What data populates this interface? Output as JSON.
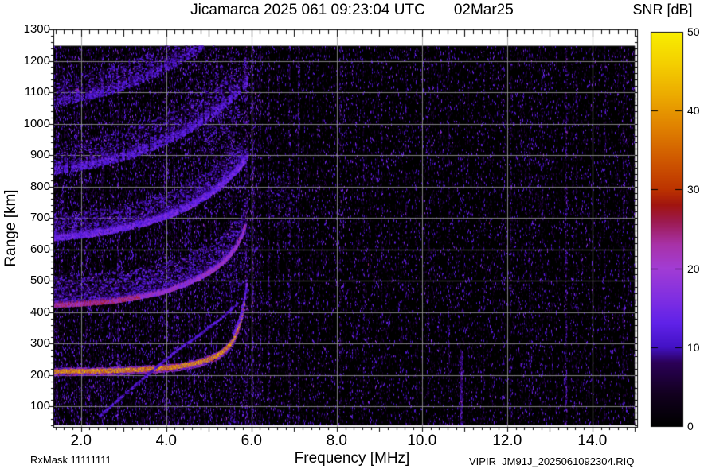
{
  "title": {
    "left": "Jicamarca 2025 061 09:23:04 UTC",
    "right": "02Mar25"
  },
  "colorbar": {
    "title": "SNR [dB]",
    "tick_values": [
      0,
      10,
      20,
      30,
      40,
      50
    ],
    "tick_labels": [
      "0",
      "10",
      "20",
      "30",
      "40",
      "50"
    ],
    "min": 0,
    "max": 50
  },
  "x_axis": {
    "label": "Frequency [MHz]",
    "tick_values": [
      2,
      4,
      6,
      8,
      10,
      12,
      14
    ],
    "tick_labels": [
      "2.0",
      "4.0",
      "6.0",
      "8.0",
      "10.0",
      "12.0",
      "14.0"
    ]
  },
  "y_axis": {
    "label": "Range [km]",
    "tick_values": [
      100,
      200,
      300,
      400,
      500,
      600,
      700,
      800,
      900,
      1000,
      1100,
      1200,
      1300
    ],
    "tick_labels": [
      "100",
      "200",
      "300",
      "400",
      "500",
      "600",
      "700",
      "800",
      "900",
      "1000",
      "1100",
      "1200",
      "1300"
    ]
  },
  "footer": {
    "rx_mask": "RxMask 11111111",
    "file": "VIPIR  JM91J_2025061092304.RIQ"
  },
  "chart_data": {
    "type": "heatmap",
    "title": "Jicamarca 2025 061 09:23:04 UTC  02Mar25",
    "xlabel": "Frequency [MHz]",
    "ylabel": "Range [km]",
    "zlabel": "SNR [dB]",
    "axes": {
      "x_min": 1.35,
      "x_max": 15.05,
      "y_min": 35,
      "y_max": 1300,
      "z_min": 0,
      "z_max": 50,
      "x_grid_step": 2,
      "y_grid_step": 100,
      "grid": true
    },
    "extent": {
      "f_min": 1.35,
      "f_max": 15.0,
      "r_min": 40,
      "r_max": 1248
    },
    "colormap": [
      [
        0,
        "#000000"
      ],
      [
        4,
        "#12001f"
      ],
      [
        8,
        "#2b0057"
      ],
      [
        10,
        "#4312c6"
      ],
      [
        13,
        "#6022e8"
      ],
      [
        16,
        "#7e2ee2"
      ],
      [
        20,
        "#a23cd4"
      ],
      [
        23,
        "#a832a8"
      ],
      [
        26,
        "#9c1a4e"
      ],
      [
        28,
        "#a01410"
      ],
      [
        30,
        "#bc3300"
      ],
      [
        34,
        "#d05b00"
      ],
      [
        38,
        "#e08200"
      ],
      [
        42,
        "#ecab00"
      ],
      [
        46,
        "#f4cf00"
      ],
      [
        50,
        "#f8ee00"
      ]
    ],
    "critical_frequency_mhz": 5.85,
    "traces": [
      {
        "name": "F-region echo 1st hop",
        "snr": 40,
        "width_km": 10,
        "core_reps": 14,
        "fringe": true,
        "points": [
          [
            1.35,
            211
          ],
          [
            2.0,
            212
          ],
          [
            2.6,
            213
          ],
          [
            3.2,
            216
          ],
          [
            3.8,
            220
          ],
          [
            4.3,
            227
          ],
          [
            4.7,
            237
          ],
          [
            5.0,
            249
          ],
          [
            5.25,
            265
          ],
          [
            5.45,
            288
          ],
          [
            5.6,
            315
          ],
          [
            5.7,
            350
          ],
          [
            5.78,
            392
          ],
          [
            5.83,
            432
          ]
        ]
      },
      {
        "name": "F-echo cusp extension",
        "snr": 14,
        "width_km": 9,
        "core_reps": 5,
        "points": [
          [
            5.58,
            330
          ],
          [
            5.72,
            375
          ],
          [
            5.82,
            430
          ],
          [
            5.9,
            492
          ]
        ]
      },
      {
        "name": "2nd hop echo",
        "snr": 19,
        "width_km": 16,
        "core_reps": 9,
        "diffuse_up_km": 85,
        "boost_below_mhz": 3.4,
        "points": [
          [
            1.35,
            424
          ],
          [
            2.0,
            428
          ],
          [
            2.7,
            436
          ],
          [
            3.3,
            448
          ],
          [
            3.9,
            465
          ],
          [
            4.4,
            488
          ],
          [
            4.8,
            512
          ],
          [
            5.15,
            540
          ],
          [
            5.45,
            575
          ],
          [
            5.65,
            610
          ],
          [
            5.78,
            645
          ],
          [
            5.86,
            678
          ]
        ]
      },
      {
        "name": "3rd hop echo",
        "snr": 14,
        "width_km": 22,
        "core_reps": 7,
        "diffuse_up_km": 65,
        "patchy": 0.15,
        "points": [
          [
            1.35,
            638
          ],
          [
            2.1,
            648
          ],
          [
            2.8,
            663
          ],
          [
            3.5,
            685
          ],
          [
            4.1,
            712
          ],
          [
            4.6,
            742
          ],
          [
            5.0,
            775
          ],
          [
            5.35,
            812
          ],
          [
            5.65,
            852
          ],
          [
            5.9,
            892
          ]
        ]
      },
      {
        "name": "4th hop echo",
        "snr": 12,
        "width_km": 26,
        "core_reps": 6,
        "diffuse_up_km": 75,
        "patchy": 0.4,
        "points": [
          [
            1.35,
            852
          ],
          [
            2.2,
            868
          ],
          [
            3.0,
            895
          ],
          [
            3.7,
            928
          ],
          [
            4.3,
            965
          ],
          [
            4.8,
            1005
          ],
          [
            5.25,
            1048
          ],
          [
            5.65,
            1095
          ],
          [
            5.9,
            1132
          ]
        ]
      },
      {
        "name": "5th hop echo",
        "snr": 11,
        "width_km": 26,
        "core_reps": 5,
        "diffuse_up_km": 65,
        "patchy": 0.45,
        "points": [
          [
            1.35,
            1065
          ],
          [
            2.2,
            1088
          ],
          [
            3.0,
            1120
          ],
          [
            3.7,
            1158
          ],
          [
            4.3,
            1200
          ],
          [
            4.8,
            1242
          ],
          [
            5.2,
            1280
          ]
        ]
      },
      {
        "name": "oblique echo",
        "snr": 11,
        "width_km": 6,
        "core_reps": 3,
        "patchy": 0.3,
        "points": [
          [
            2.45,
            70
          ],
          [
            3.0,
            135
          ],
          [
            3.6,
            205
          ],
          [
            4.2,
            272
          ],
          [
            4.8,
            330
          ],
          [
            5.3,
            382
          ],
          [
            5.68,
            428
          ]
        ]
      }
    ],
    "diffuse_patches": [
      {
        "f": [
          4.35,
          6.05
        ],
        "r": [
          720,
          1255
        ],
        "amp": 13,
        "density": 0.55
      },
      {
        "f": [
          6.3,
          7.05
        ],
        "r": [
          620,
          900
        ],
        "amp": 11,
        "density": 0.4
      },
      {
        "f": [
          5.0,
          6.05
        ],
        "r": [
          430,
          700
        ],
        "amp": 12,
        "density": 0.45
      },
      {
        "f": [
          1.35,
          3.0
        ],
        "r": [
          100,
          200
        ],
        "amp": 8,
        "density": 0.2
      },
      {
        "f": [
          3.7,
          4.8
        ],
        "r": [
          55,
          140
        ],
        "amp": 10,
        "density": 0.3
      },
      {
        "f": [
          8.6,
          10.2
        ],
        "r": [
          450,
          560
        ],
        "amp": 7,
        "density": 0.15
      }
    ],
    "rfi_stripes": [
      {
        "f": 1.42,
        "amp": 0.8
      },
      {
        "f": 2.12,
        "amp": 0.45
      },
      {
        "f": 2.5,
        "amp": 0.5
      },
      {
        "f": 2.86,
        "amp": 0.85
      },
      {
        "f": 3.28,
        "amp": 0.5
      },
      {
        "f": 3.62,
        "amp": 0.55
      },
      {
        "f": 3.95,
        "amp": 0.5
      },
      {
        "f": 4.18,
        "amp": 0.65
      },
      {
        "f": 4.55,
        "amp": 0.6
      },
      {
        "f": 4.9,
        "amp": 0.55
      },
      {
        "f": 5.18,
        "amp": 0.5
      },
      {
        "f": 5.52,
        "amp": 0.65
      },
      {
        "f": 5.88,
        "amp": 1.15,
        "w": 4
      },
      {
        "f": 6.03,
        "amp": 0.85
      },
      {
        "f": 6.2,
        "amp": 0.6
      },
      {
        "f": 6.4,
        "amp": 0.65
      },
      {
        "f": 6.62,
        "amp": 0.5
      },
      {
        "f": 6.88,
        "amp": 0.8
      },
      {
        "f": 7.1,
        "amp": 1.0
      },
      {
        "f": 7.55,
        "amp": 0.4
      },
      {
        "f": 8.08,
        "amp": 0.5
      },
      {
        "f": 8.62,
        "amp": 0.4
      },
      {
        "f": 9.05,
        "amp": 0.45
      },
      {
        "f": 9.62,
        "amp": 0.4
      },
      {
        "f": 10.15,
        "amp": 0.4
      },
      {
        "f": 10.62,
        "amp": 0.5
      },
      {
        "f": 10.92,
        "amp": 0.9,
        "r": [
          40,
          280
        ]
      },
      {
        "f": 11.45,
        "amp": 0.4
      },
      {
        "f": 12.08,
        "amp": 0.5
      },
      {
        "f": 12.52,
        "amp": 0.55
      },
      {
        "f": 12.82,
        "amp": 0.45
      },
      {
        "f": 13.38,
        "amp": 0.95
      },
      {
        "f": 13.62,
        "amp": 0.5
      },
      {
        "f": 14.28,
        "amp": 0.5
      },
      {
        "f": 14.72,
        "amp": 0.45
      }
    ],
    "noise": {
      "base_density_low_freq": 1.0,
      "base_density_high_freq": 0.5,
      "low_high_boundary_mhz": 6.2,
      "speckle_min_db": 3,
      "speckle_max_db": 15
    }
  }
}
